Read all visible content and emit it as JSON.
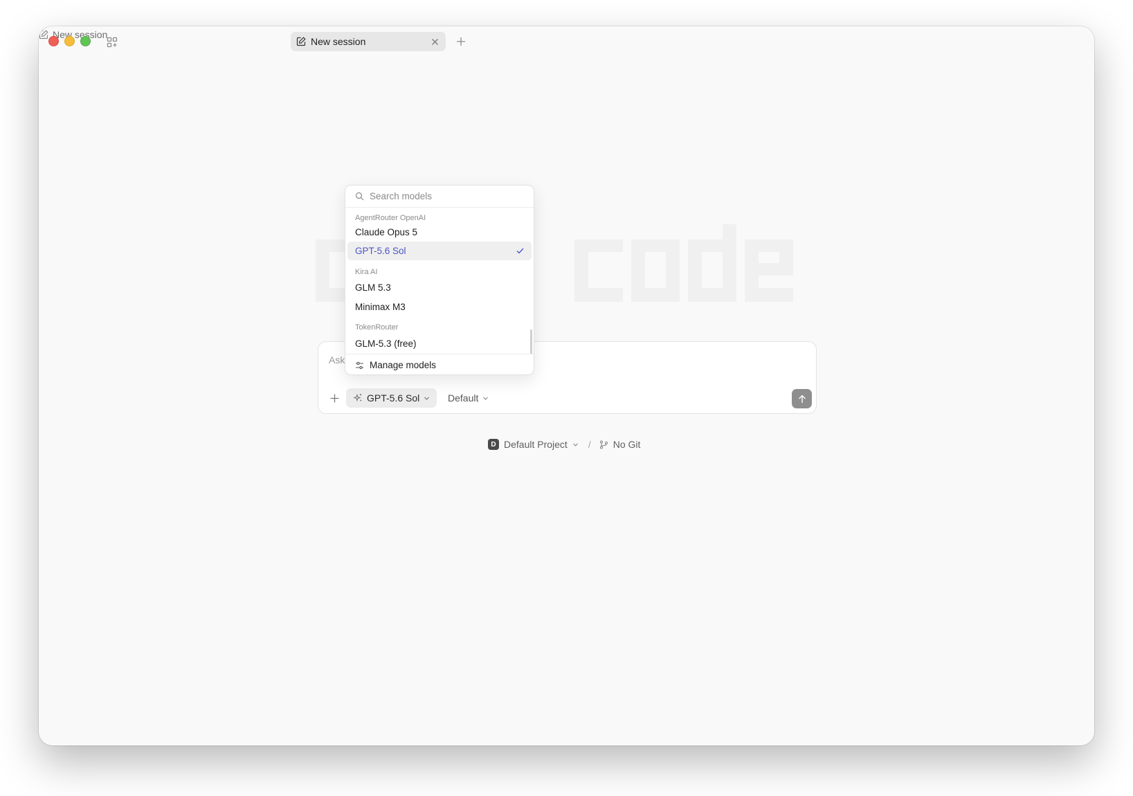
{
  "titlebar": {
    "new_session_button_label": "New session",
    "tabs": [
      {
        "label": "New session",
        "active": true
      }
    ]
  },
  "watermark": {
    "text": "opencode"
  },
  "composer": {
    "placeholder": "Ask anything...",
    "model_chip_label": "GPT-5.6 Sol",
    "mode_label": "Default"
  },
  "project_bar": {
    "project_badge": "D",
    "project_name": "Default Project",
    "separator": "/",
    "git_label": "No Git"
  },
  "model_dropdown": {
    "search_placeholder": "Search models",
    "groups": [
      {
        "name": "AgentRouter OpenAI",
        "models": [
          {
            "label": "Claude Opus 5"
          },
          {
            "label": "GPT-5.6 Sol",
            "selected": true
          }
        ]
      },
      {
        "name": "Kira AI",
        "models": [
          {
            "label": "GLM 5.3"
          },
          {
            "label": "Minimax M3"
          }
        ]
      },
      {
        "name": "TokenRouter",
        "models": [
          {
            "label": "GLM-5.3 (free)"
          }
        ]
      }
    ],
    "footer_label": "Manage models"
  },
  "colors": {
    "accent_selected_text": "#4a55c8",
    "window_bg": "#f9f9f9",
    "send_button_bg": "#8e8e8e"
  }
}
